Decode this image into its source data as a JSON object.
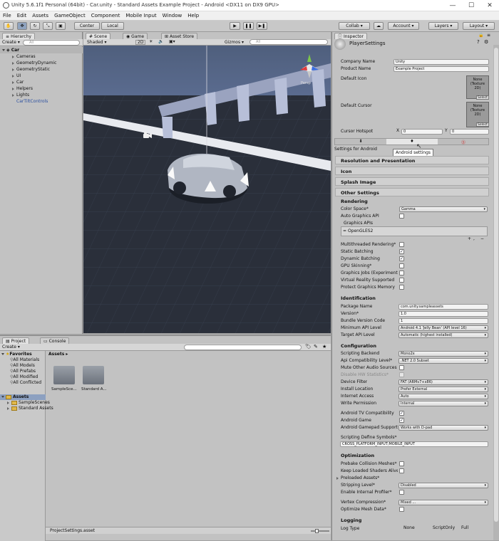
{
  "window": {
    "title": "Unity 5.6.1f1 Personal (64bit) - Car.unity - Standard Assets Example Project - Android <DX11 on DX9 GPU>",
    "minimize": "—",
    "maximize": "☐",
    "close": "✕"
  },
  "menu": [
    "File",
    "Edit",
    "Assets",
    "GameObject",
    "Component",
    "Mobile Input",
    "Window",
    "Help"
  ],
  "toolbar": {
    "center": "Center",
    "local": "Local",
    "collab": "Collab ▾",
    "account": "Account ▾",
    "layers": "Layers",
    "layout": "Layout"
  },
  "hierarchy": {
    "tab": "Hierarchy",
    "create": "Create ▾",
    "search": "All",
    "scene": "Car",
    "items": [
      "Cameras",
      "GeometryDynamic",
      "GeometryStatic",
      "UI",
      "Car",
      "Helpers",
      "Lights",
      "CarTiltControls"
    ]
  },
  "scene_view": {
    "tabs": [
      "Scene",
      "Game",
      "Asset Store"
    ],
    "shaded": "Shaded",
    "twod": "2D",
    "gizmos": "Gizmos ▾",
    "search": "All",
    "persp": "Persp"
  },
  "project": {
    "tabs": [
      "Project",
      "Console"
    ],
    "create": "Create ▾",
    "favorites_label": "Favorites",
    "favorites": [
      "All Materials",
      "All Models",
      "All Prefabs",
      "All Modified",
      "All Conflicted"
    ],
    "assets_label": "Assets",
    "assets_tree": [
      "SampleScenes",
      "Standard Assets"
    ],
    "breadcrumb": "Assets ▸",
    "grid": [
      "SampleSce...",
      "Standard A..."
    ],
    "footer_file": "ProjectSettings.asset"
  },
  "inspector": {
    "tab": "Inspector",
    "header": "PlayerSettings",
    "company_label": "Company Name",
    "company_value": "Unity",
    "product_label": "Product Name",
    "product_value": "Example Project",
    "default_icon_label": "Default Icon",
    "default_cursor_label": "Default Cursor",
    "texture_none": "None\n(Texture\n2D)",
    "select": "Select",
    "hotspot_label": "Cursor Hotspot",
    "hotspot_x_label": "X",
    "hotspot_x": "0",
    "hotspot_y_label": "Y",
    "hotspot_y": "0",
    "settings_for": "Settings for Android",
    "tooltip": "Android settings",
    "sections": [
      "Resolution and Presentation",
      "Icon",
      "Splash Image",
      "Other Settings"
    ],
    "rendering_head": "Rendering",
    "color_space_label": "Color Space*",
    "color_space_value": "Gamma",
    "auto_graphics_label": "Auto Graphics API",
    "graphics_apis_label": "Graphics APIs",
    "gles": "OpenGLES2",
    "addremove": "+, −",
    "rendering_checks": [
      {
        "label": "Multithreaded Rendering*",
        "checked": false
      },
      {
        "label": "Static Batching",
        "checked": true
      },
      {
        "label": "Dynamic Batching",
        "checked": true
      },
      {
        "label": "GPU Skinning*",
        "checked": false
      },
      {
        "label": "Graphics Jobs (Experimental)*",
        "checked": false
      },
      {
        "label": "Virtual Reality Supported",
        "checked": false
      },
      {
        "label": "Protect Graphics Memory",
        "checked": false
      }
    ],
    "identification_head": "Identification",
    "identification": [
      {
        "label": "Package Name",
        "value": "com.unity.sampleassets",
        "kind": "field"
      },
      {
        "label": "Version*",
        "value": "1.0",
        "kind": "field"
      },
      {
        "label": "Bundle Version Code",
        "value": "1",
        "kind": "field"
      },
      {
        "label": "Minimum API Level",
        "value": "Android 4.1 'Jelly Bean' (API level 16)",
        "kind": "dd"
      },
      {
        "label": "Target API Level",
        "value": "Automatic (highest installed)",
        "kind": "dd"
      }
    ],
    "configuration_head": "Configuration",
    "scripting_backend_label": "Scripting Backend",
    "scripting_backend_value": "Mono2x",
    "api_compat_label": "Api Compatibility Level*",
    "api_compat_value": ".NET 2.0 Subset",
    "mute_audio_label": "Mute Other Audio Sources",
    "disable_hw_label": "Disable HW Statistics*",
    "device_filter_label": "Device Filter",
    "device_filter_value": "FAT (ARMv7+x86)",
    "install_location_label": "Install Location",
    "install_location_value": "Prefer External",
    "internet_access_label": "Internet Access",
    "internet_access_value": "Auto",
    "write_permission_label": "Write Permission",
    "write_permission_value": "Internal",
    "android_tv_label": "Android TV Compatibility",
    "android_game_label": "Android Game",
    "gamepad_label": "Android Gamepad Support Level",
    "gamepad_value": "Works with D-pad",
    "define_symbols_label": "Scripting Define Symbols*",
    "define_symbols_value": "CROSS_PLATFORM_INPUT;MOBILE_INPUT",
    "optimization_head": "Optimization",
    "prebake_label": "Prebake Collision Meshes*",
    "keep_shaders_label": "Keep Loaded Shaders Alive*",
    "preloaded_label": "Preloaded Assets*",
    "stripping_label": "Stripping Level*",
    "stripping_value": "Disabled",
    "internal_profiler_label": "Enable Internal Profiler*",
    "vertex_compression_label": "Vertex Compression*",
    "vertex_compression_value": "Mixed ...",
    "optimize_mesh_label": "Optimize Mesh Data*",
    "logging_head": "Logging",
    "log_type_label": "Log Type",
    "log_cols": [
      "None",
      "ScriptOnly",
      "Full"
    ]
  }
}
